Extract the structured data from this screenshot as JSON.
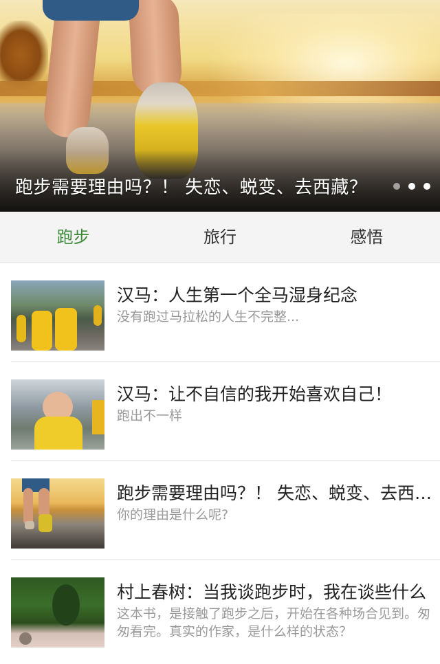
{
  "banner": {
    "caption": "跑步需要理由吗？！ 失恋、蜕变、去西藏？",
    "dots": 3,
    "active_dot": 2
  },
  "tabs": [
    {
      "label": "跑步",
      "active": true
    },
    {
      "label": "旅行",
      "active": false
    },
    {
      "label": "感悟",
      "active": false
    }
  ],
  "articles": [
    {
      "title": "汉马：人生第一个全马湿身纪念",
      "desc": "没有跑过马拉松的人生不完整..."
    },
    {
      "title": "汉马：让不自信的我开始喜欢自己！",
      "desc": "跑出不一样"
    },
    {
      "title": "跑步需要理由吗？！ 失恋、蜕变、去西藏？",
      "desc": "你的理由是什么呢?"
    },
    {
      "title": "村上春树：当我谈跑步时，我在谈些什么",
      "desc": "这本书，是接触了跑步之后，开始在各种场合见到。匆匆看完。真实的作家，是什么样的状态？"
    }
  ],
  "colors": {
    "active_tab": "#3f8a3a",
    "tab_bar_bg": "#f4f4f4",
    "desc_text": "#9a9a9a"
  }
}
